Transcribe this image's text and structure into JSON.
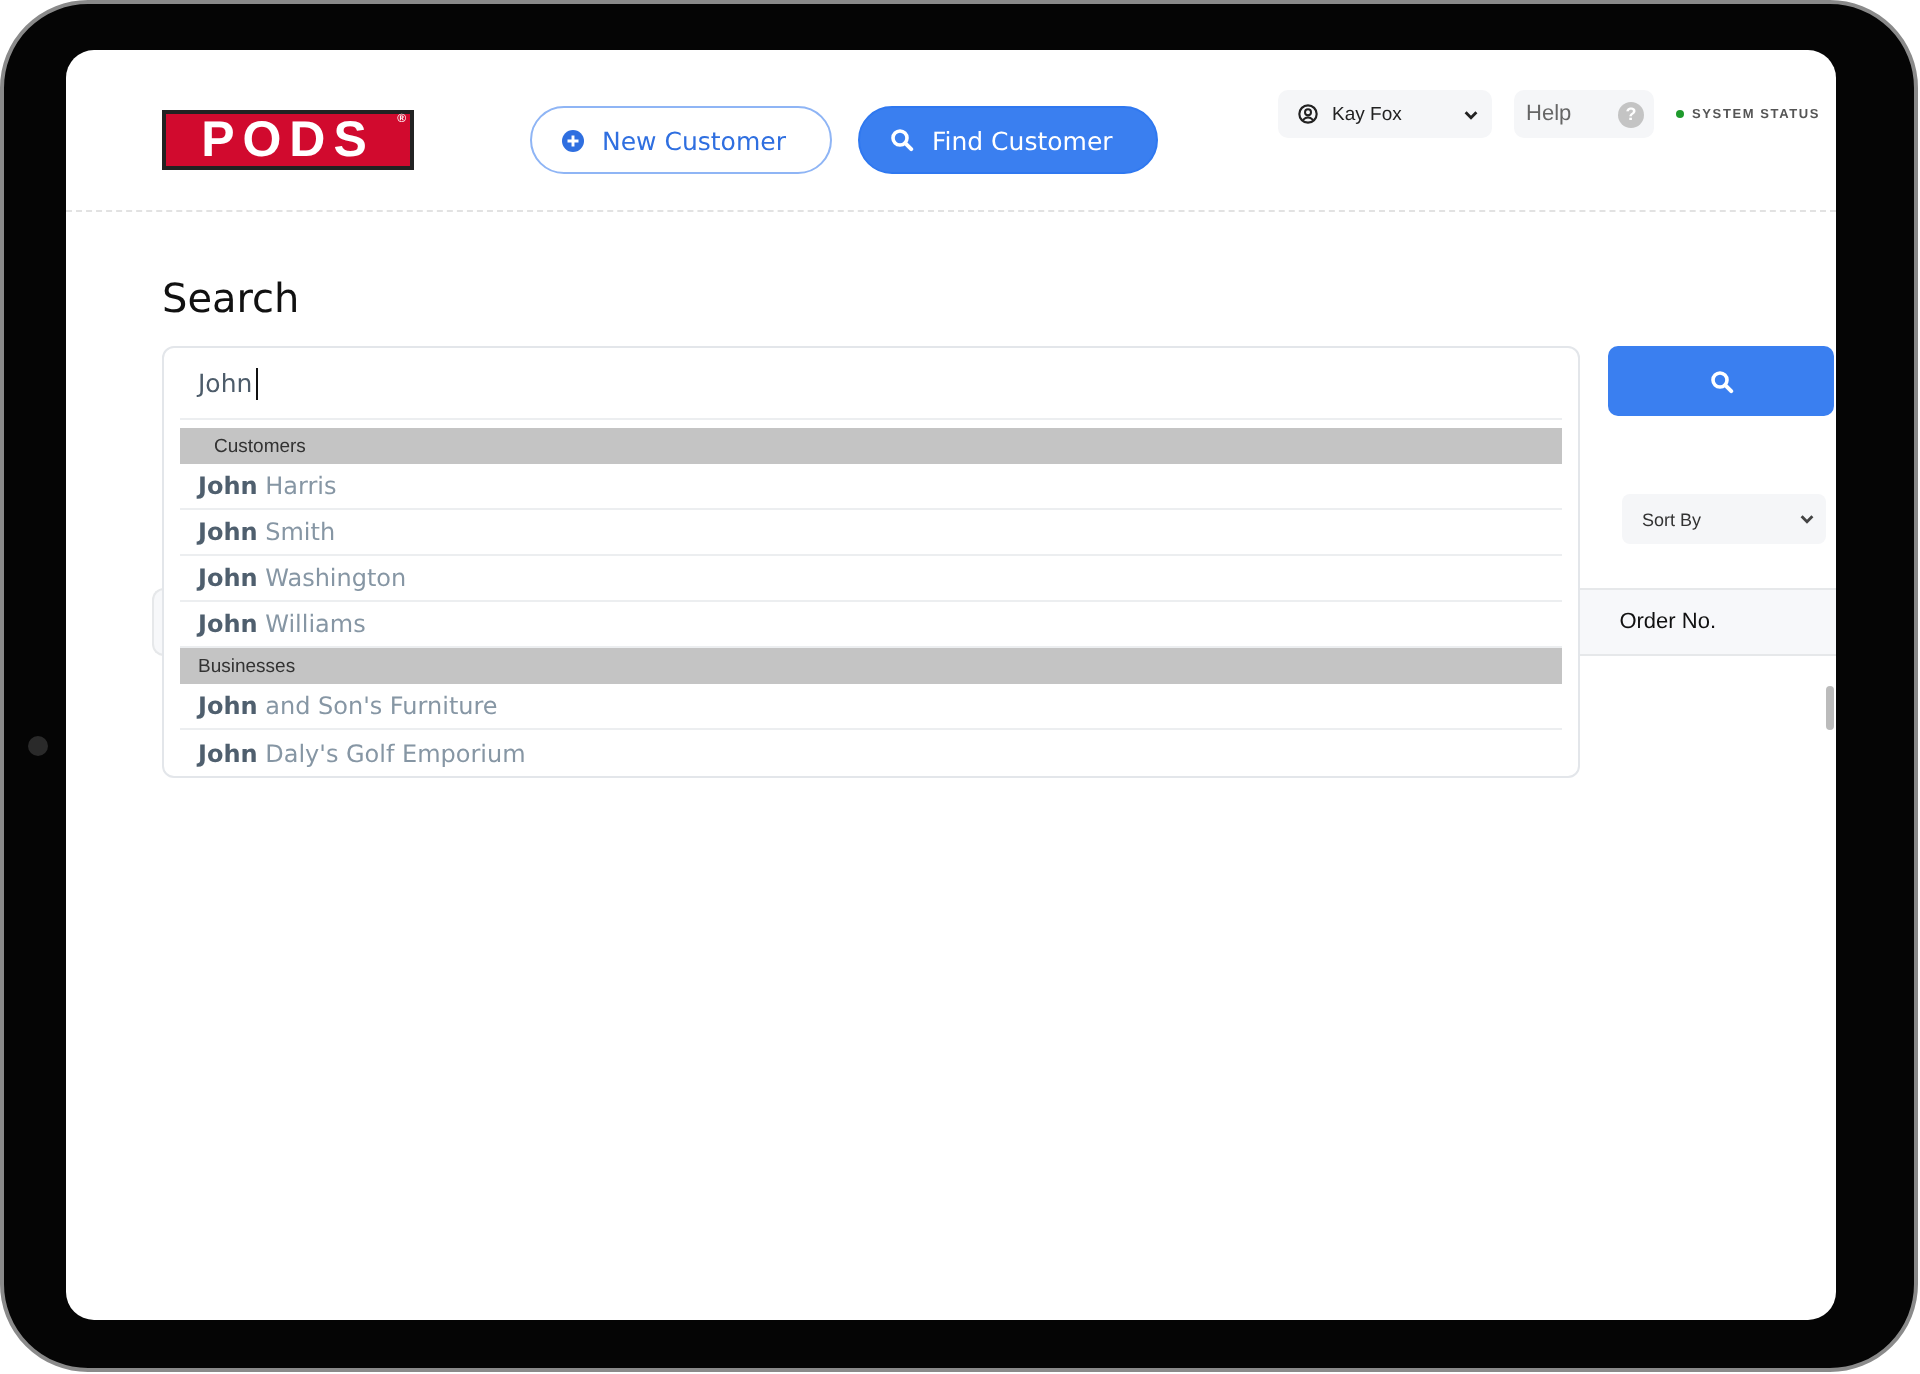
{
  "logo": {
    "text": "PODS",
    "mark": "®"
  },
  "header_buttons": [
    {
      "label": "New Customer",
      "kind": "new",
      "selected": false
    },
    {
      "label": "Find Customer",
      "kind": "find",
      "selected": true
    }
  ],
  "user_menu": {
    "label": "Kay Fox"
  },
  "help": {
    "label": "Help",
    "icon": "?"
  },
  "system_status": {
    "label": "SYSTEM STATUS"
  },
  "search": {
    "title": "Search",
    "value": "John",
    "groups": [
      {
        "title": "Customers",
        "items": [
          "**John** Harris",
          "**John** Smith",
          "**John** Washington",
          "**John** Williams"
        ]
      },
      {
        "title": "Businesses",
        "items": [
          "**John** and Son's Furniture",
          "**John** Daly's Golf Emporium"
        ]
      }
    ]
  },
  "results": {
    "sort": {
      "placeholder": "Sort By"
    },
    "columns": [
      "Order No."
    ]
  }
}
